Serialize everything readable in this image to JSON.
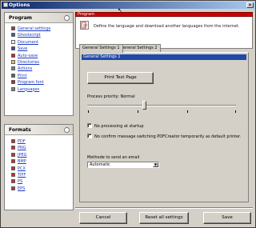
{
  "window": {
    "title": "Options"
  },
  "sidebar": {
    "program": {
      "title": "Program",
      "items": [
        {
          "label": "General settings",
          "icon": "settings-icon",
          "color": "#b03030"
        },
        {
          "label": "Ghostscript",
          "icon": "ghost-icon",
          "color": "#3060b0"
        },
        {
          "label": "Document",
          "icon": "document-icon",
          "color": "#ffffff"
        },
        {
          "label": "Save",
          "icon": "save-icon",
          "color": "#4040a0"
        },
        {
          "label": "Auto-save",
          "icon": "autosave-icon",
          "color": "#cc2020"
        },
        {
          "label": "Directories",
          "icon": "folder-icon",
          "color": "#e8c060"
        },
        {
          "label": "Actions",
          "icon": "actions-icon",
          "color": "#808080"
        },
        {
          "label": "Print",
          "icon": "print-icon",
          "color": "#606060"
        },
        {
          "label": "Program font",
          "icon": "font-icon",
          "color": "#a03030"
        },
        {
          "label": "Languages",
          "icon": "languages-icon",
          "color": "#808080"
        }
      ]
    },
    "formats": {
      "title": "Formats",
      "items": [
        {
          "label": "PDF",
          "icon": "pdf-icon",
          "color": "#c03030"
        },
        {
          "label": "PNG",
          "icon": "png-icon",
          "color": "#c03030"
        },
        {
          "label": "JPEG",
          "icon": "jpeg-icon",
          "color": "#c03030"
        },
        {
          "label": "BMP",
          "icon": "bmp-icon",
          "color": "#c03030"
        },
        {
          "label": "PCX",
          "icon": "pcx-icon",
          "color": "#c03030"
        },
        {
          "label": "TIFF",
          "icon": "tiff-icon",
          "color": "#c03030"
        },
        {
          "label": "PS",
          "icon": "ps-icon",
          "color": "#c03030"
        },
        {
          "label": "EPS",
          "icon": "eps-icon",
          "color": "#c03030"
        }
      ]
    }
  },
  "main": {
    "header": "Program",
    "description": "Define the language and download another languages from the internet.",
    "tabs": [
      "General Settings 1",
      "General Settings 2"
    ],
    "page_title": "General Settings 1",
    "print_test_page": "Print Test Page",
    "process_priority_label": "Process priority: Normal",
    "process_priority_level": 0.38,
    "no_processing_label": "No processing at startup",
    "no_processing_checked": false,
    "no_confirm_label": "No confirm message switching PDFCreator temporarily as default printer.",
    "no_confirm_checked": false,
    "email_method_label": "Methode to send an email",
    "email_method_value": "Automatic"
  },
  "footer": {
    "cancel": "Cancel",
    "reset": "Reset all settings",
    "save": "Save"
  },
  "colors": {
    "title_gradient_start": "#0a246a",
    "header_red": "#cc0000",
    "page_head_blue": "#1f4aa8",
    "link": "#1a3ac4"
  }
}
